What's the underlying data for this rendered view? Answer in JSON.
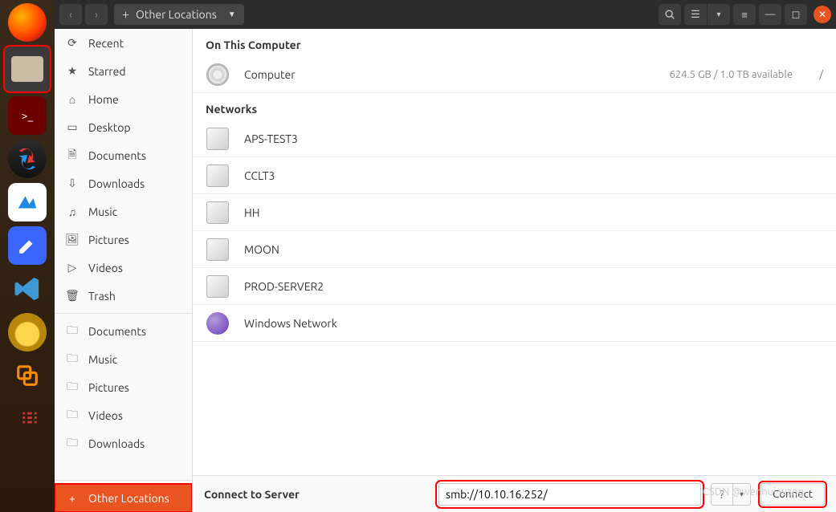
{
  "header": {
    "location_label": "Other Locations"
  },
  "sidebar": {
    "primary": [
      {
        "icon": "⟳",
        "label": "Recent"
      },
      {
        "icon": "★",
        "label": "Starred"
      },
      {
        "icon": "⌂",
        "label": "Home"
      },
      {
        "icon": "▭",
        "label": "Desktop"
      },
      {
        "icon": "🗎",
        "label": "Documents"
      },
      {
        "icon": "⇩",
        "label": "Downloads"
      },
      {
        "icon": "♫",
        "label": "Music"
      },
      {
        "icon": "🖼",
        "label": "Pictures"
      },
      {
        "icon": "▷",
        "label": "Videos"
      },
      {
        "icon": "🗑",
        "label": "Trash"
      }
    ],
    "mounts": [
      {
        "icon": "🗀",
        "label": "Documents"
      },
      {
        "icon": "🗀",
        "label": "Music"
      },
      {
        "icon": "🗀",
        "label": "Pictures"
      },
      {
        "icon": "🗀",
        "label": "Videos"
      },
      {
        "icon": "🗀",
        "label": "Downloads"
      }
    ],
    "other_locations_label": "Other Locations"
  },
  "main": {
    "section_computer": "On This Computer",
    "computer": {
      "label": "Computer",
      "meta": "624.5 GB / 1.0 TB available",
      "path": "/"
    },
    "section_networks": "Networks",
    "networks": [
      {
        "label": "APS-TEST3"
      },
      {
        "label": "CCLT3"
      },
      {
        "label": "HH"
      },
      {
        "label": "MOON"
      },
      {
        "label": "PROD-SERVER2"
      }
    ],
    "windows_network_label": "Windows Network"
  },
  "connect": {
    "label": "Connect to Server",
    "value": "smb://10.10.16.252/",
    "button": "Connect"
  },
  "watermark": "CSDN @wenhui.wang"
}
